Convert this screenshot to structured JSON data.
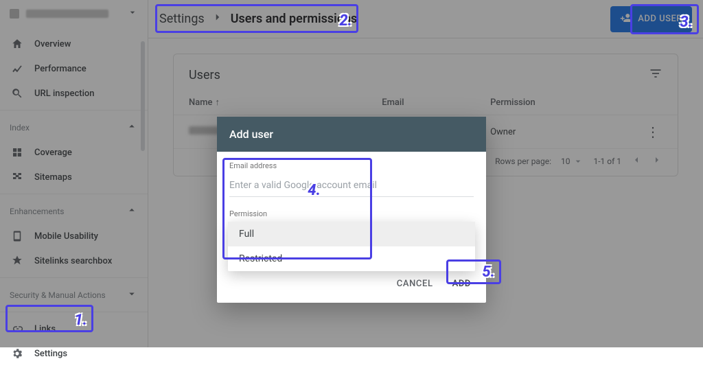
{
  "colors": {
    "accent": "#1a73e8",
    "modal_header": "#455a64",
    "annotation": "#4a3fe4"
  },
  "breadcrumb": {
    "root": "Settings",
    "current": "Users and permissions"
  },
  "add_user_button": "ADD USER",
  "sidebar": {
    "items_top": [
      {
        "icon": "home",
        "label": "Overview"
      },
      {
        "icon": "performance",
        "label": "Performance"
      },
      {
        "icon": "search",
        "label": "URL inspection"
      }
    ],
    "groups": [
      {
        "title": "Index",
        "items": [
          {
            "icon": "coverage",
            "label": "Coverage"
          },
          {
            "icon": "sitemaps",
            "label": "Sitemaps"
          }
        ]
      },
      {
        "title": "Enhancements",
        "items": [
          {
            "icon": "mobile",
            "label": "Mobile Usability"
          },
          {
            "icon": "sitelinks",
            "label": "Sitelinks searchbox"
          }
        ]
      },
      {
        "title": "Security & Manual Actions",
        "items": []
      }
    ],
    "bottom": [
      {
        "icon": "links",
        "label": "Links"
      },
      {
        "icon": "settings",
        "label": "Settings"
      }
    ]
  },
  "card": {
    "title": "Users",
    "columns": {
      "name": "Name",
      "email": "Email",
      "permission": "Permission"
    },
    "rows": [
      {
        "name_redacted": true,
        "email": "",
        "permission": "Owner"
      }
    ],
    "pager": {
      "rows_per_page_label": "Rows per page:",
      "rows_per_page": "10",
      "range": "1-1 of 1"
    }
  },
  "modal": {
    "title": "Add user",
    "email_label": "Email address",
    "email_placeholder": "Enter a valid Google account email",
    "permission_label": "Permission",
    "options": [
      "Full",
      "Restricted"
    ],
    "cancel": "CANCEL",
    "add": "ADD"
  },
  "annotations": {
    "1": "1.",
    "2": "2.",
    "3": "3.",
    "4": "4.",
    "5": "5."
  }
}
